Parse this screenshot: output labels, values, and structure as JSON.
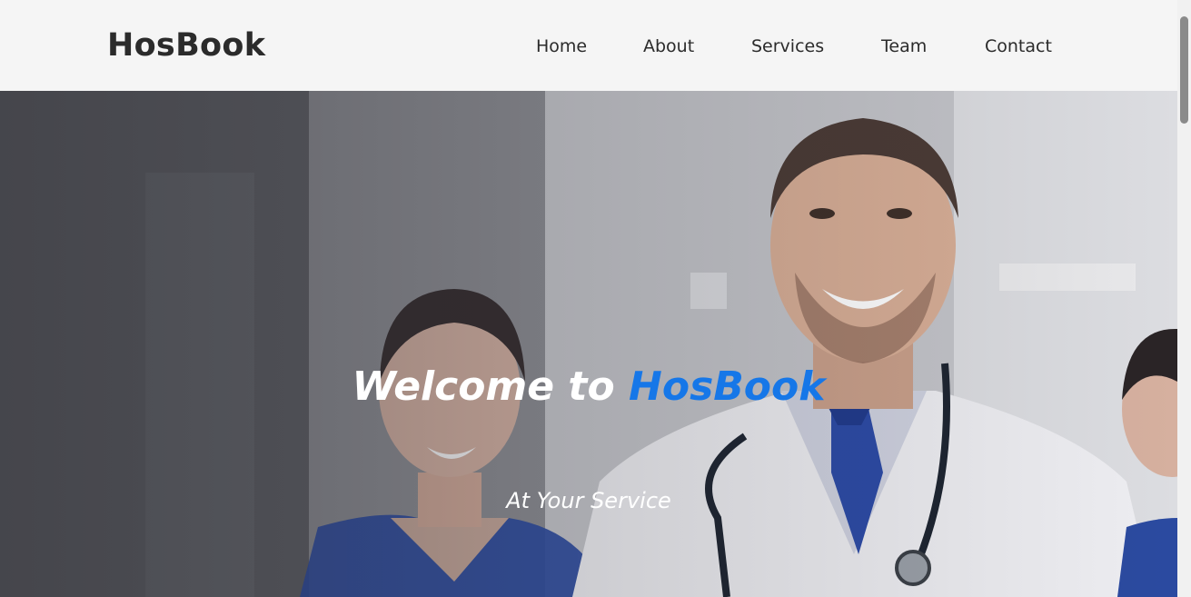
{
  "header": {
    "logo": "HosBook",
    "nav": [
      "Home",
      "About",
      "Services",
      "Team",
      "Contact"
    ]
  },
  "hero": {
    "title_prefix": "Welcome to",
    "title_brand": "HosBook",
    "subtitle": "At Your Service"
  },
  "colors": {
    "brand_accent": "#1677e8",
    "header_bg": "#f5f5f5",
    "text_dark": "#2b2b2b"
  }
}
